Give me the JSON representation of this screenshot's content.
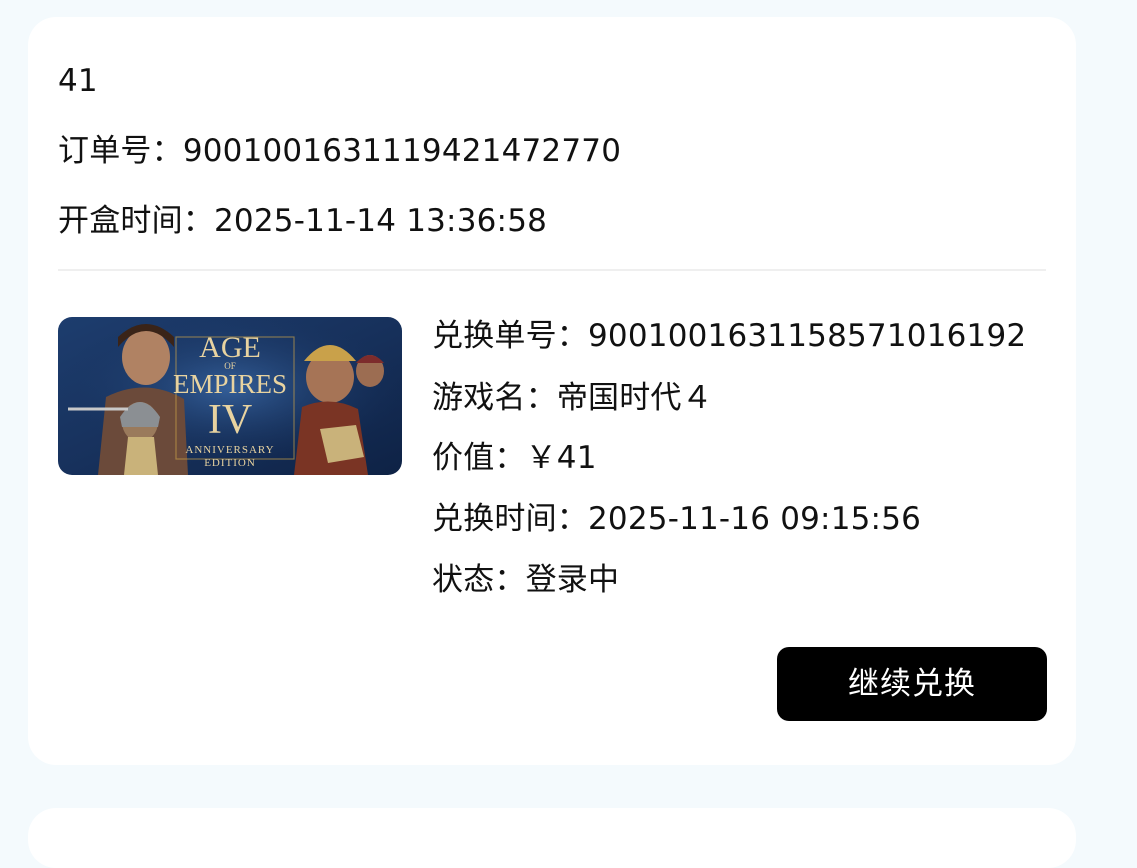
{
  "order": {
    "amount": "41",
    "order_no_label": "订单号：",
    "order_no": "90010016311194214727​70",
    "open_time_label": "开盒时间：",
    "open_time": "2025-11-14 13:36:58"
  },
  "item": {
    "cover_title_line1": "AGE",
    "cover_title_of": "OF",
    "cover_title_line2": "EMPIRES",
    "cover_title_line3": "IV",
    "cover_sub1": "ANNIVERSARY",
    "cover_sub2": "EDITION",
    "redeem_no_label": "兑换单号：",
    "redeem_no": "90010016311585710161​92",
    "game_name_label": "游戏名：",
    "game_name": "帝国时代４",
    "value_label": "价值：",
    "value": "￥41",
    "redeem_time_label": "兑换时间：",
    "redeem_time": "2025-11-16 09:15:56",
    "status_label": "状态：",
    "status": "登录中"
  },
  "actions": {
    "continue_label": "继续兑换"
  },
  "colors": {
    "page_bg": "#f4fafd",
    "card_bg": "#ffffff",
    "button_bg": "#000000",
    "button_text": "#ffffff"
  }
}
